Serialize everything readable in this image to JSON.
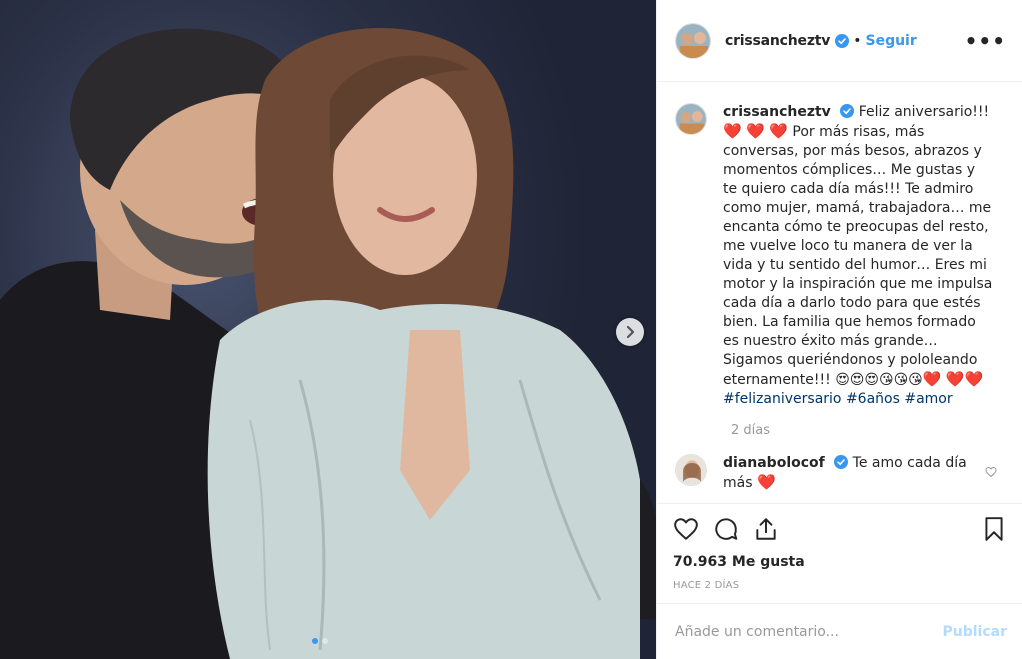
{
  "post": {
    "username": "crissancheztv",
    "separator": "•",
    "follow_label": "Seguir",
    "more_label": "•••",
    "caption": {
      "text_1": "Feliz aniversario!!!",
      "text_2": "Por más risas, más conversas, por más besos, abrazos y momentos cómplices… Me gustas y te quiero cada día más!!! Te admiro como mujer, mamá, trabajadora… me encanta cómo te preocupas del resto, me vuelve loco tu manera de ver la vida y tu sentido del humor… Eres mi motor y la inspiración que me impulsa cada día a darlo todo para que estés bien. La familia que hemos formado es nuestro éxito más grande… Sigamos queriéndonos y pololeando eternamente!!!",
      "emojis": "😍😍😍😘😘😘",
      "hashtags": [
        "#felizaniversario",
        "#6años",
        "#amor"
      ],
      "time_ago": "2 días"
    },
    "comments": [
      {
        "username": "dianabolocof",
        "text": "Te amo cada día más"
      }
    ],
    "likes": "70.963 Me gusta",
    "posted": "HACE 2 DÍAS",
    "add_comment_placeholder": "Añade un comentario...",
    "publish_label": "Publicar",
    "colors": {
      "accent": "#3897f0",
      "heart": "#e0245e",
      "hashtag": "#003569",
      "muted": "#999999"
    },
    "icons": [
      "verified-icon",
      "heart-icon",
      "comment-icon",
      "share-icon",
      "bookmark-icon",
      "chevron-right-icon",
      "more-options-icon"
    ]
  }
}
